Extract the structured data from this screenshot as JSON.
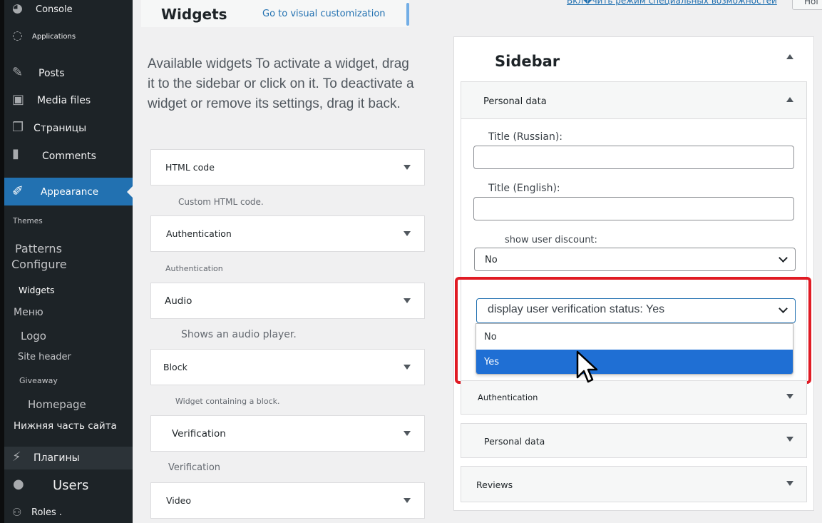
{
  "sidebar": {
    "items": [
      {
        "label": "Console",
        "icon": "dashboard-icon"
      },
      {
        "label": "Applications",
        "icon": "applications-icon"
      },
      {
        "label": "Posts",
        "icon": "pin-icon"
      },
      {
        "label": "Media files",
        "icon": "media-icon"
      },
      {
        "label": "Страницы",
        "icon": "pages-icon"
      },
      {
        "label": "Comments",
        "icon": "comment-icon"
      },
      {
        "label": "Appearance",
        "icon": "brush-icon",
        "active": true
      }
    ],
    "submenu": [
      "Themes",
      "Patterns",
      "Configure",
      "Widgets",
      "Меню",
      "Logo",
      "Site header",
      "Giveaway",
      "Homepage",
      "Нижняя часть сайта"
    ],
    "after": [
      {
        "label": "Плагины",
        "icon": "plugin-icon"
      },
      {
        "label": "Users",
        "icon": "user-icon"
      },
      {
        "label": "Roles .",
        "icon": "roles-icon"
      }
    ]
  },
  "header": {
    "title": "Widgets",
    "visual_link": "Go to visual customization",
    "topbar_link": "Вкл�чить режим специальных возможностей",
    "topbar_button": "Ноі"
  },
  "main": {
    "description": "Available widgets To activate a widget, drag it to the sidebar or click on it. To deactivate a widget or remove its settings, drag it back.",
    "widgets": [
      {
        "title": "HTML code",
        "desc": "Custom HTML code."
      },
      {
        "title": "Authentication",
        "desc": "Authentication"
      },
      {
        "title": "Audio",
        "desc": "Shows an audio player."
      },
      {
        "title": "Block",
        "desc": "Widget containing a block."
      },
      {
        "title": "Verification",
        "desc": "Verification"
      },
      {
        "title": "Video",
        "desc": ""
      }
    ]
  },
  "panel": {
    "title": "Sidebar",
    "personal_data": {
      "title": "Personal data",
      "title_ru_label": "Title (Russian):",
      "title_ru_value": "",
      "title_en_label": "Title (English):",
      "title_en_value": "",
      "discount_label": "show user discount:",
      "discount_value": "No",
      "verification_select": "display user verification status: Yes",
      "options": [
        "No",
        "Yes"
      ],
      "selected_option": "Yes"
    },
    "collapsed": [
      "Authentication",
      "Personal data",
      "Reviews"
    ]
  },
  "colors": {
    "accent": "#2271b1",
    "sidebar_bg": "#1d2327",
    "highlight_border": "#e01b24",
    "selected_option": "#1f6fd4"
  }
}
